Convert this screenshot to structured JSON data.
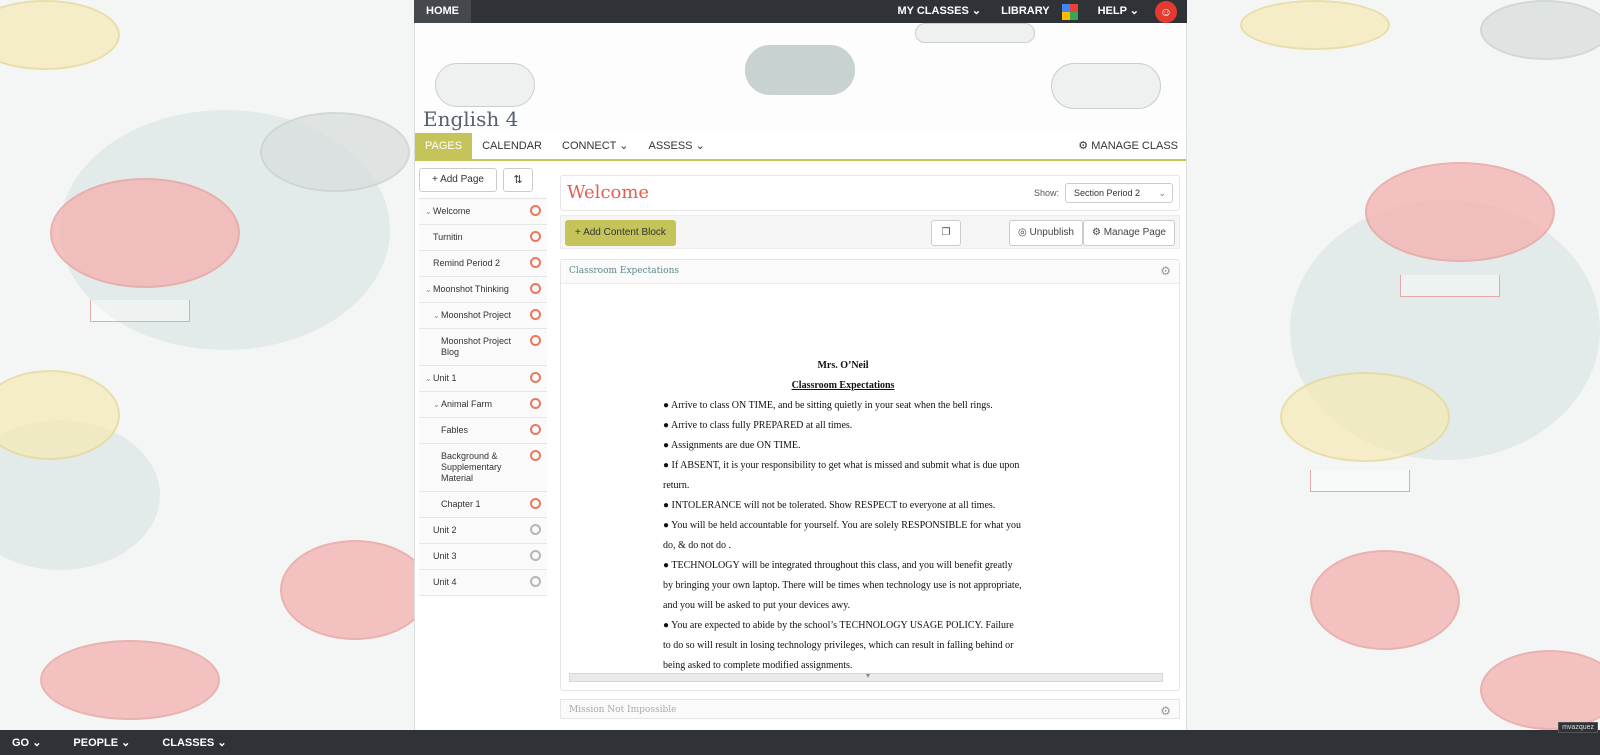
{
  "topbar": {
    "home": "HOME",
    "my_classes": "MY CLASSES",
    "library": "LIBRARY",
    "help": "HELP",
    "colors": {
      "bar": "#2f3337",
      "avatar": "#e63a30"
    }
  },
  "class": {
    "title": "English 4",
    "tabs": [
      {
        "label": "PAGES"
      },
      {
        "label": "CALENDAR"
      },
      {
        "label": "CONNECT"
      },
      {
        "label": "ASSESS"
      }
    ],
    "manage": "MANAGE CLASS",
    "accent": "#c5c45a"
  },
  "sidebar": {
    "add_page": "Add Page",
    "items": [
      {
        "label": "Welcome"
      },
      {
        "label": "Turnitin"
      },
      {
        "label": "Remind Period 2"
      },
      {
        "label": "Moonshot Thinking"
      },
      {
        "label": "Moonshot Project"
      },
      {
        "label": "Moonshot Project Blog"
      },
      {
        "label": "Unit 1"
      },
      {
        "label": "Animal Farm"
      },
      {
        "label": "Fables"
      },
      {
        "label": "Background & Supplementary Material"
      },
      {
        "label": "Chapter 1"
      },
      {
        "label": "Unit 2"
      },
      {
        "label": "Unit 3"
      },
      {
        "label": "Unit 4"
      }
    ]
  },
  "page": {
    "title": "Welcome",
    "show_label": "Show:",
    "show_value": "Section Period 2",
    "add_block": "Add Content Block",
    "unpublish": "Unpublish",
    "manage_page": "Manage Page"
  },
  "block": {
    "title": "Classroom Expectations",
    "teacher": "Mrs. O’Neil",
    "heading": "Classroom Expectations",
    "lines": [
      "● Arrive to class ON TIME, and be sitting quietly in your seat when the bell rings.",
      "● Arrive to class fully PREPARED at all times.",
      "● Assignments are due ON TIME.",
      "● If ABSENT, it is your responsibility to get what is missed and submit what is due upon return.",
      "● INTOLERANCE will not be tolerated. Show RESPECT to everyone at all times.",
      "● You will be held accountable for yourself. You are solely RESPONSIBLE for what you do, & do not do .",
      "● TECHNOLOGY will be integrated throughout this class, and you will benefit greatly by bringing your own laptop. There will be times when technology use is not appropriate, and you will be asked to put your devices awy.",
      "● You are expected to abide by the school’s TECHNOLOGY USAGE POLICY. Failure to do so will result in losing technology privileges, which can result in falling behind or being asked to complete modified assignments."
    ]
  },
  "next_block": {
    "title": "Mission Not Impossible"
  },
  "bottombar": {
    "go": "GO",
    "people": "PEOPLE",
    "classes": "CLASSES",
    "user": "mvazquez"
  }
}
